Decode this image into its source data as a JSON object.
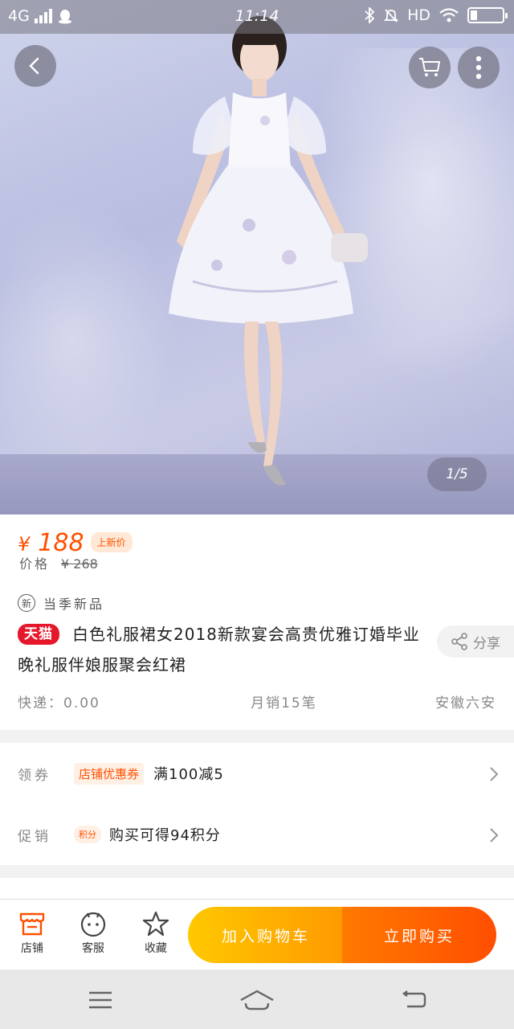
{
  "status_bar": {
    "network": "4G",
    "time": "11:14",
    "hd": "HD"
  },
  "gallery": {
    "pager": "1/5"
  },
  "product": {
    "price_symbol": "¥",
    "price": "188",
    "price_tag": "上新价",
    "original_label": "价格",
    "original_price": "¥ 268",
    "season_badge": "新",
    "season_label": "当季新品",
    "platform_badge": "天猫",
    "title": "白色礼服裙女2018新款宴会高贵优雅订婚毕业晚礼服伴娘服聚会红裙",
    "share_label": "分享",
    "shipping": "快递：0.00",
    "sales": "月销15笔",
    "location": "安徽六安"
  },
  "promotions": {
    "coupon_label": "领券",
    "coupon_tag": "店铺优惠券",
    "coupon_text": "满100减5",
    "promo_label": "促销",
    "points_tag": "积分",
    "promo_text": "购买可得94积分"
  },
  "bottom_bar": {
    "store_label": "店铺",
    "service_label": "客服",
    "favorite_label": "收藏",
    "add_to_cart": "加入购物车",
    "buy_now": "立即购买"
  },
  "colors": {
    "accent": "#ff5000",
    "tmall_red": "#e5172b",
    "cart_yellow": "#ffb400",
    "buy_orange": "#ff5a00"
  }
}
